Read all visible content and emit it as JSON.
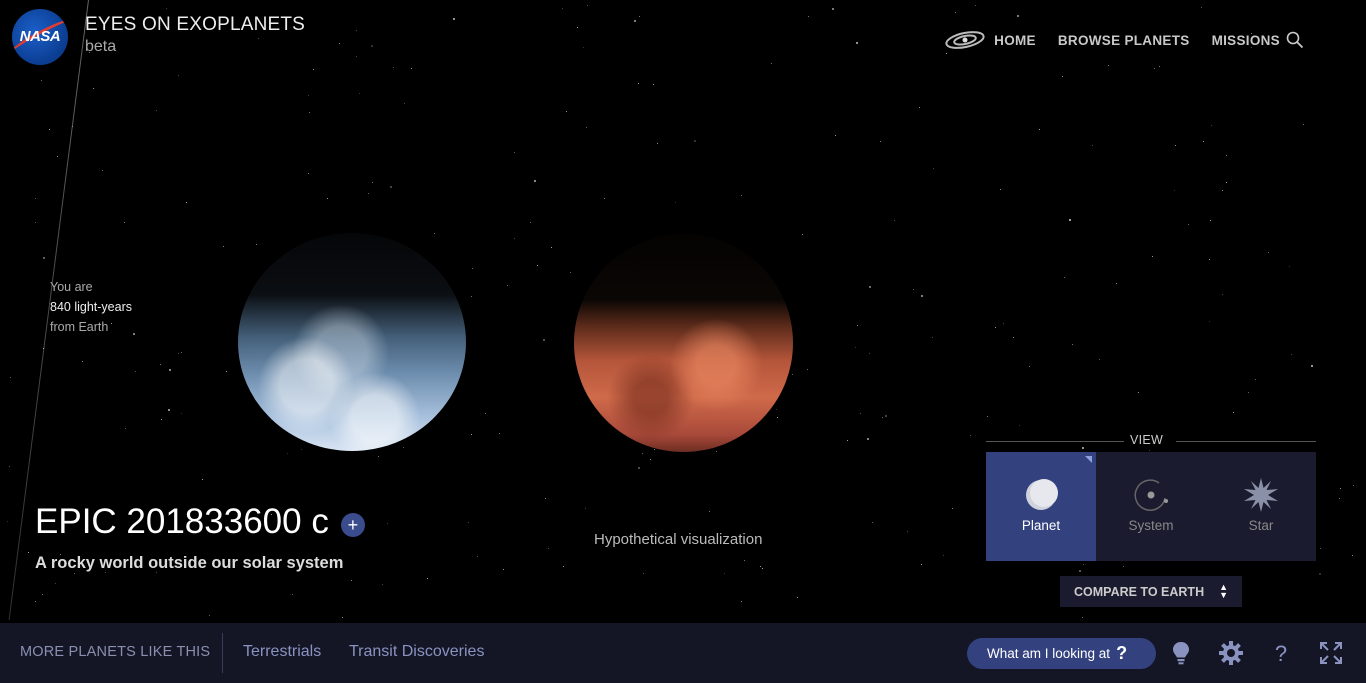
{
  "header": {
    "logo_text": "NASA",
    "app_title": "EYES ON EXOPLANETS",
    "app_subtitle": "beta",
    "nav": [
      {
        "label": "HOME",
        "icon": "galaxy-icon"
      },
      {
        "label": "BROWSE PLANETS"
      },
      {
        "label": "MISSIONS"
      }
    ],
    "search_icon": "search-icon"
  },
  "distance": {
    "line1": "You are",
    "line2": "840 light-years",
    "line3": "from Earth"
  },
  "visualization": {
    "caption": "Hypothetical visualization"
  },
  "planet": {
    "name": "EPIC 201833600 c",
    "add_label": "+",
    "tagline": "A rocky world outside our solar system"
  },
  "view_panel": {
    "label": "VIEW",
    "options": [
      {
        "label": "Planet",
        "active": true
      },
      {
        "label": "System",
        "active": false
      },
      {
        "label": "Star",
        "active": false
      }
    ],
    "compare_label": "COMPARE TO EARTH"
  },
  "bottom_bar": {
    "more_label": "MORE PLANETS LIKE THIS",
    "categories": [
      "Terrestrials",
      "Transit Discoveries"
    ],
    "what_label": "What am I looking at",
    "what_icon": "?",
    "icons": [
      "lightbulb-icon",
      "gear-icon",
      "help-icon",
      "fullscreen-icon"
    ]
  },
  "colors": {
    "accent": "#33427f",
    "panel_bg": "#1a1b2e",
    "bottom_bg": "#141626"
  }
}
